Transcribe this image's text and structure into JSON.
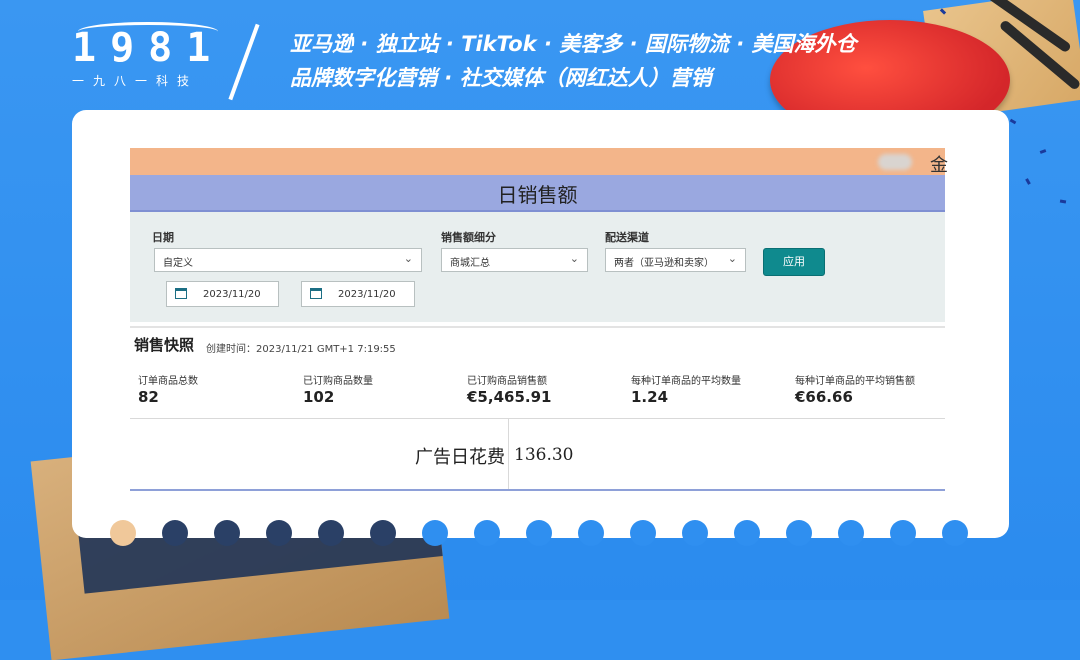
{
  "brand": {
    "logo_text": "1981",
    "logo_sub": "一九八一科技"
  },
  "header": {
    "line1": "亚马逊 · 独立站 · TikTok · 美客多 · 国际物流 · 美国海外仓",
    "line2": "品牌数字化营销 · 社交媒体（网红达人）营销"
  },
  "screenshot": {
    "topbar_char": "金",
    "title": "日销售额",
    "filters": {
      "date_label": "日期",
      "date_value": "自定义",
      "breakdown_label": "销售额细分",
      "breakdown_value": "商城汇总",
      "channel_label": "配送渠道",
      "channel_value": "两者（亚马逊和卖家）",
      "start_date": "2023/11/20",
      "end_date": "2023/11/20",
      "apply_label": "应用"
    },
    "snapshot": {
      "heading": "销售快照",
      "created": "创建时间：2023/11/21 GMT+1 7:19:55",
      "metrics": [
        {
          "label": "订单商品总数",
          "value": "82"
        },
        {
          "label": "已订购商品数量",
          "value": "102"
        },
        {
          "label": "已订购商品销售额",
          "value": "€5,465.91"
        },
        {
          "label": "每种订单商品的平均数量",
          "value": "1.24"
        },
        {
          "label": "每种订单商品的平均销售额",
          "value": "€66.66"
        }
      ]
    },
    "ad": {
      "label": "广告日花费",
      "value": "136.30"
    }
  },
  "colors": {
    "background": "#2f8ff0",
    "topbar": "#f3b58a",
    "titlebar": "#9aa8e0",
    "apply_button": "#0f8a8e"
  }
}
